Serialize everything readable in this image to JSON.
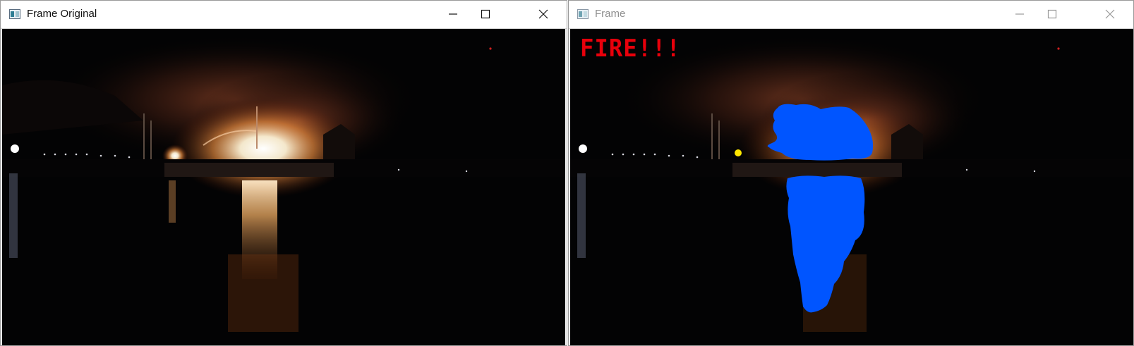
{
  "windows": [
    {
      "title": "Frame Original",
      "active": true
    },
    {
      "title": "Frame",
      "active": false
    }
  ],
  "overlay": {
    "alert_text": "FIRE!!!",
    "alert_color": "#e8000b",
    "mask_color": "#0055ff",
    "marker_color": "#ffe600"
  },
  "icons": [
    "app-window-icon",
    "minimize-icon",
    "maximize-icon",
    "close-icon"
  ]
}
